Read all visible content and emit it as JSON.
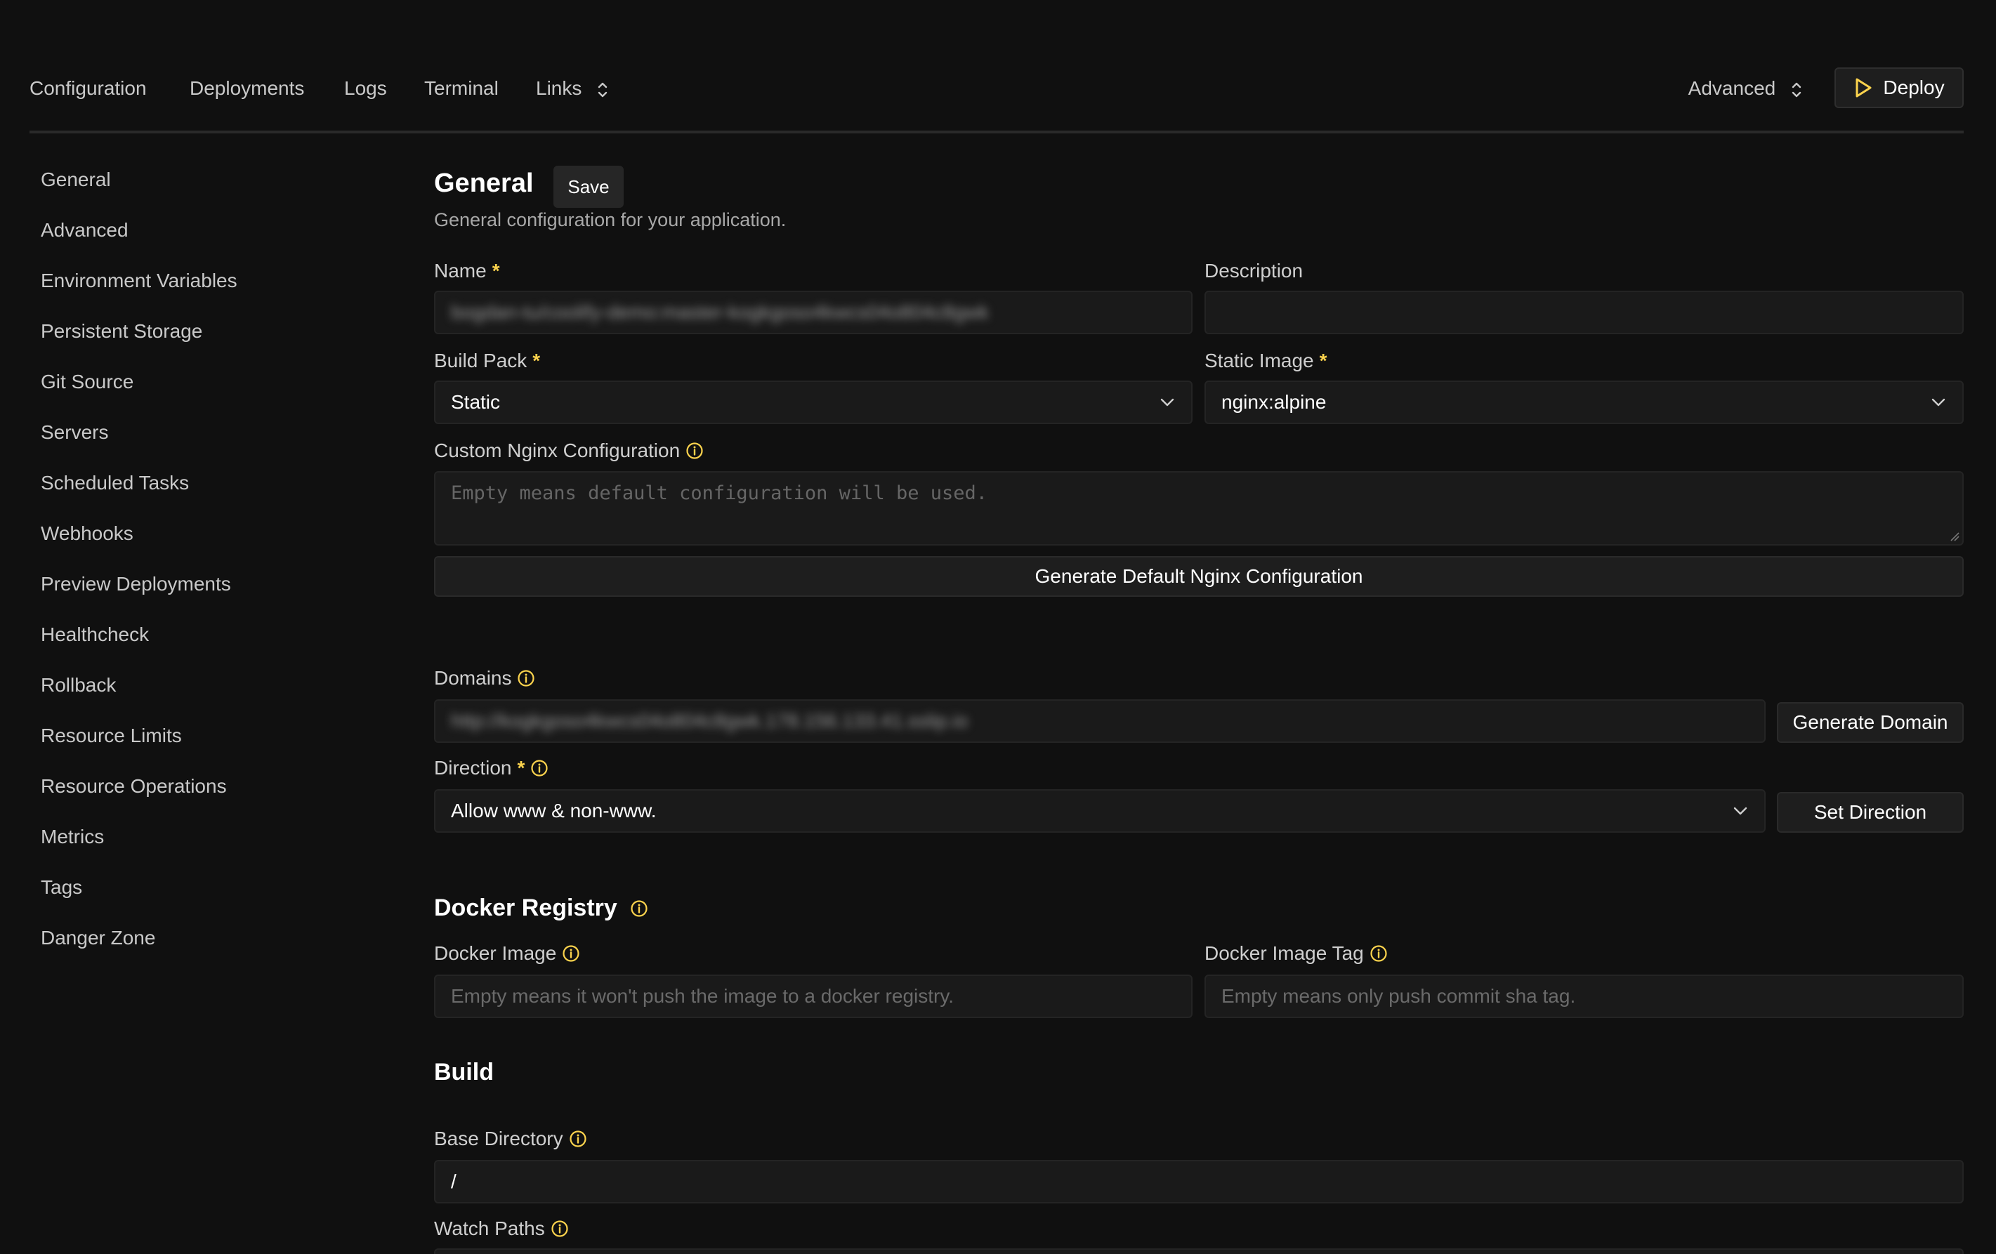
{
  "topnav": {
    "tabs": [
      "Configuration",
      "Deployments",
      "Logs",
      "Terminal",
      "Links"
    ],
    "advanced_label": "Advanced",
    "deploy_label": "Deploy"
  },
  "sidebar": {
    "items": [
      "General",
      "Advanced",
      "Environment Variables",
      "Persistent Storage",
      "Git Source",
      "Servers",
      "Scheduled Tasks",
      "Webhooks",
      "Preview Deployments",
      "Healthcheck",
      "Rollback",
      "Resource Limits",
      "Resource Operations",
      "Metrics",
      "Tags",
      "Danger Zone"
    ]
  },
  "general": {
    "title": "General",
    "save_label": "Save",
    "subtitle": "General configuration for your application.",
    "name_label": "Name",
    "name_value": "bogdan-tu/coolify-demo:master-kogkgoso4kwcs04o804c8gwk",
    "description_label": "Description",
    "description_value": "",
    "build_pack_label": "Build Pack",
    "build_pack_value": "Static",
    "static_image_label": "Static Image",
    "static_image_value": "nginx:alpine",
    "nginx_label": "Custom Nginx Configuration",
    "nginx_placeholder": "Empty means default configuration will be used.",
    "generate_nginx_label": "Generate Default Nginx Configuration",
    "domains_label": "Domains",
    "domains_value": "http://kogkgoso4kwcs04o804c8gwk.178.156.133.41.sslip.io",
    "generate_domain_label": "Generate Domain",
    "direction_label": "Direction",
    "direction_value": "Allow www & non-www.",
    "set_direction_label": "Set Direction"
  },
  "docker_registry": {
    "title": "Docker Registry",
    "image_label": "Docker Image",
    "image_placeholder": "Empty means it won't push the image to a docker registry.",
    "tag_label": "Docker Image Tag",
    "tag_placeholder": "Empty means only push commit sha tag."
  },
  "build": {
    "title": "Build",
    "base_dir_label": "Base Directory",
    "base_dir_value": "/",
    "watch_paths_label": "Watch Paths"
  },
  "colors": {
    "accent": "#fcd34d",
    "background": "#101010",
    "field_bg": "#1a1a1a"
  }
}
